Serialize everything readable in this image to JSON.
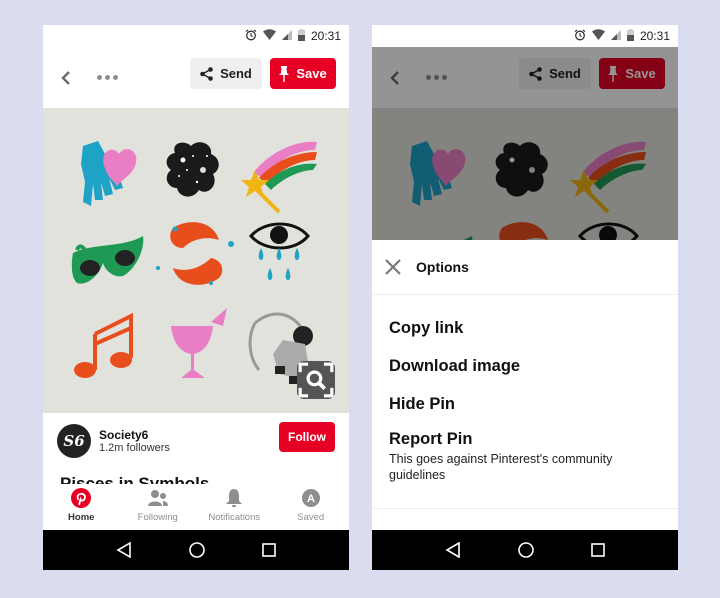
{
  "status_bar": {
    "time": "20:31",
    "icons": [
      "alarm-icon",
      "wifi-icon",
      "signal-icon",
      "battery-icon"
    ]
  },
  "pin_header": {
    "back_icon": "chevron-left-icon",
    "more_icon": "more-dots-icon",
    "send_label": "Send",
    "save_label": "Save"
  },
  "pin": {
    "image_description": "Grid of nine colorful symbol illustrations: hand with heart, galaxy cloud, shooting star, sunglasses, pisces fish, crying eye, music note, cocktail glass, astronaut",
    "visual_search_icon": "lens-search-icon",
    "title": "Pisces in Symbols"
  },
  "creator": {
    "avatar_text": "S6",
    "name": "Society6",
    "followers": "1.2m followers",
    "follow_label": "Follow"
  },
  "tabs": [
    {
      "label": "Home",
      "icon": "pinterest-logo-icon",
      "active": true
    },
    {
      "label": "Following",
      "icon": "people-icon",
      "active": false
    },
    {
      "label": "Notifications",
      "icon": "bell-icon",
      "active": false
    },
    {
      "label": "Saved",
      "icon": "profile-initial-icon",
      "initial": "A",
      "active": false
    }
  ],
  "options_sheet": {
    "title": "Options",
    "close_icon": "close-x-icon",
    "items": [
      {
        "label": "Copy link"
      },
      {
        "label": "Download image"
      },
      {
        "label": "Hide Pin"
      },
      {
        "label": "Report Pin",
        "sublabel": "This goes against Pinterest's community guidelines"
      }
    ]
  },
  "colors": {
    "brand_red": "#e60023",
    "background": "#d9ddef",
    "image_bg": "#e2e2dd"
  }
}
